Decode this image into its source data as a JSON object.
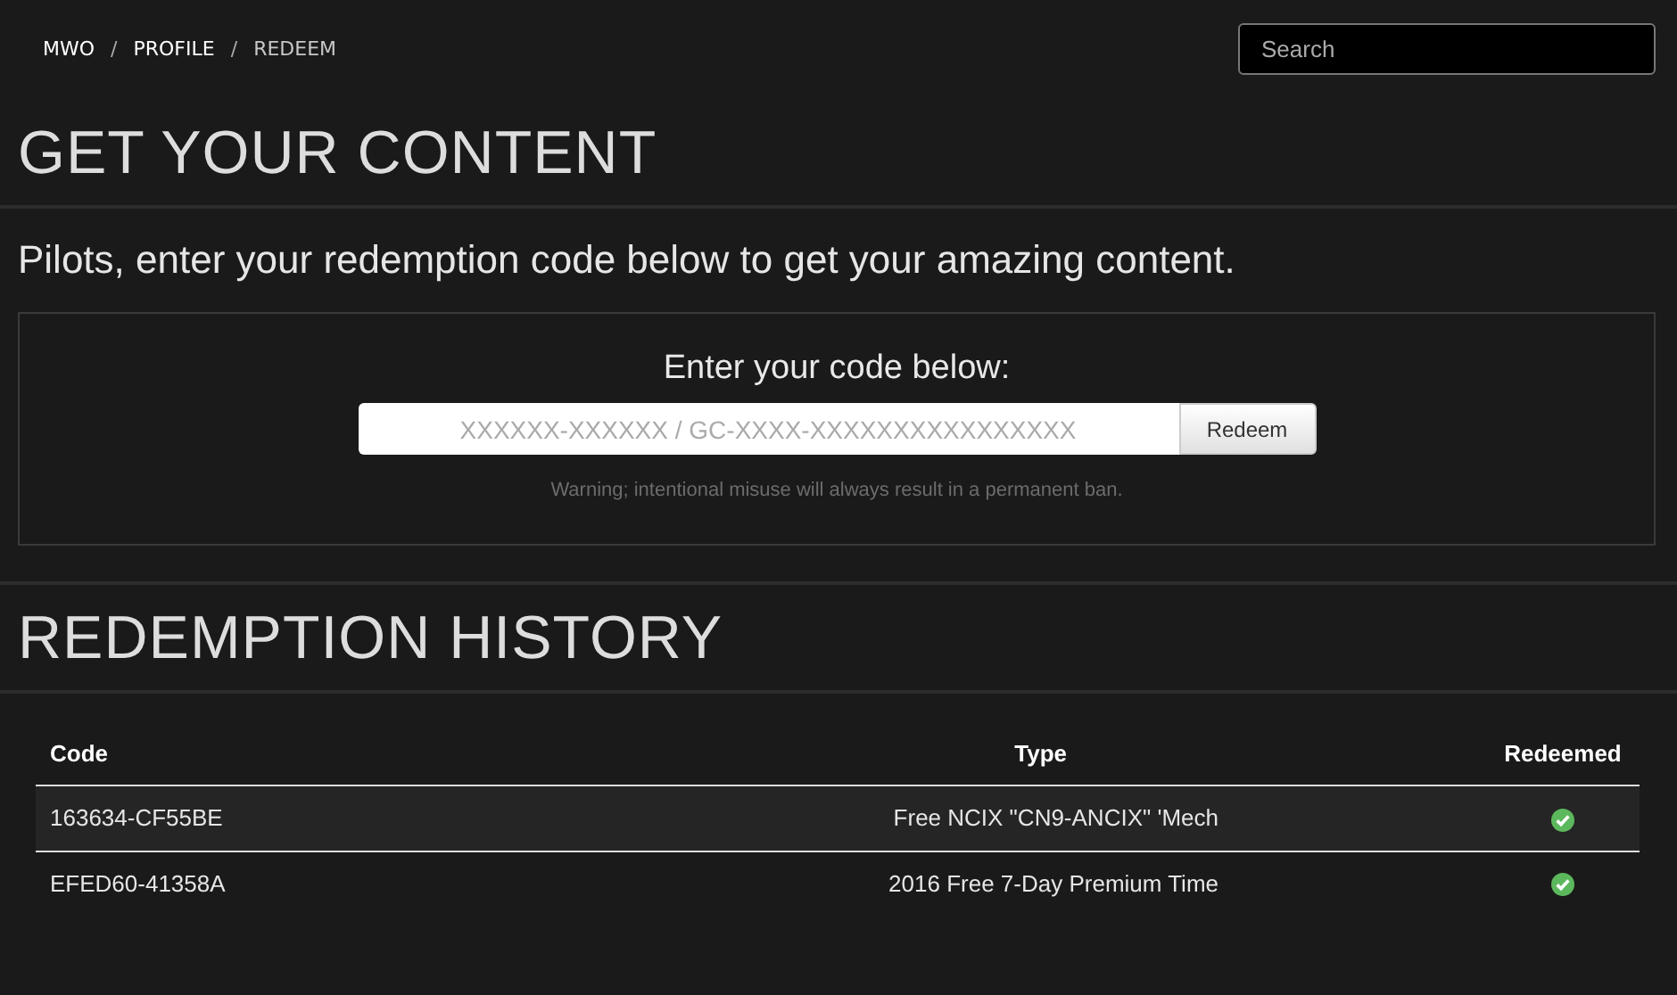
{
  "breadcrumbs": [
    {
      "label": "MWO",
      "selected": false
    },
    {
      "label": "PROFILE",
      "selected": false
    },
    {
      "label": "REDEEM",
      "selected": true
    }
  ],
  "breadcrumb_separator": "/",
  "search": {
    "placeholder": "Search"
  },
  "title": "GET YOUR CONTENT",
  "intro": "Pilots, enter your redemption code below to get your amazing content.",
  "redeem_box": {
    "heading": "Enter your code below:",
    "placeholder": "XXXXXX-XXXXXX / GC-XXXX-XXXXXXXXXXXXXXXX",
    "button": "Redeem",
    "warning": "Warning; intentional misuse will always result in a permanent ban."
  },
  "history_title": "REDEMPTION HISTORY",
  "table": {
    "columns": [
      "Code",
      "Type",
      "Redeemed"
    ],
    "rows": [
      {
        "code": "163634-CF55BE",
        "type": "Free NCIX \"CN9-ANCIX\" 'Mech",
        "redeemed": true
      },
      {
        "code": "EFED60-41358A",
        "type": "2016 Free 7-Day Premium Time",
        "redeemed": true
      }
    ]
  }
}
